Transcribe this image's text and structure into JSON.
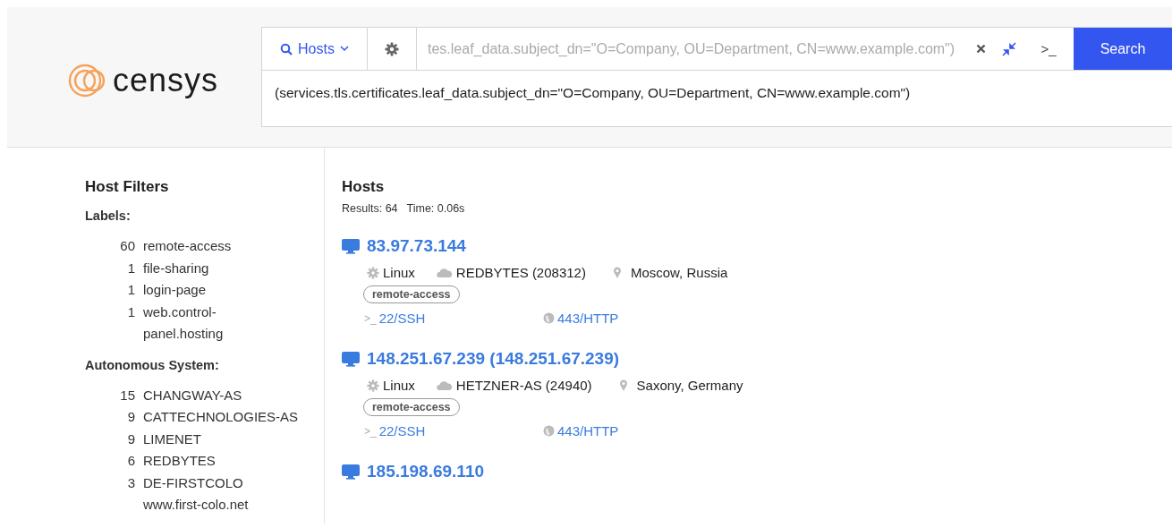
{
  "header": {
    "logo_text": "censys",
    "search": {
      "type_label": "Hosts",
      "value": "tes.leaf_data.subject_dn=\"O=Company, OU=Department, CN=www.example.com\")",
      "terminal_glyph": ">_",
      "button": "Search",
      "query": "(services.tls.certificates.leaf_data.subject_dn=\"O=Company, OU=Department, CN=www.example.com\")"
    }
  },
  "sidebar": {
    "title": "Host Filters",
    "sections": [
      {
        "title": "Labels:",
        "kind": "labels",
        "items": [
          {
            "count": "60",
            "name": "remote-access"
          },
          {
            "count": "1",
            "name": "file-sharing"
          },
          {
            "count": "1",
            "name": "login-page"
          },
          {
            "count": "1",
            "name": "web.control-panel.hosting"
          }
        ]
      },
      {
        "title": "Autonomous System:",
        "kind": "as",
        "items": [
          {
            "count": "15",
            "name": "CHANGWAY-AS"
          },
          {
            "count": "9",
            "name": "CATTECHNOLOGIES-AS"
          },
          {
            "count": "9",
            "name": "LIMENET"
          },
          {
            "count": "6",
            "name": "REDBYTES"
          },
          {
            "count": "3",
            "name": "DE-FIRSTCOLO www.first-colo.net"
          }
        ]
      }
    ]
  },
  "results": {
    "title": "Hosts",
    "summary": [
      "Results: 64",
      "Time: 0.06s"
    ],
    "hosts": [
      {
        "ip": "83.97.73.144",
        "os": "Linux",
        "as": "REDBYTES (208312)",
        "location": "Moscow, Russia",
        "labels": [
          "remote-access"
        ],
        "services": [
          {
            "kind": "terminal",
            "glyph": ">_",
            "name": "22/SSH"
          },
          {
            "kind": "web",
            "name": "443/HTTP"
          }
        ]
      },
      {
        "ip": "148.251.67.239 (148.251.67.239)",
        "os": "Linux",
        "as": "HETZNER-AS (24940)",
        "location": "Saxony, Germany",
        "labels": [
          "remote-access"
        ],
        "services": [
          {
            "kind": "terminal",
            "glyph": ">_",
            "name": "22/SSH"
          },
          {
            "kind": "web",
            "name": "443/HTTP"
          }
        ]
      },
      {
        "ip": "185.198.69.110"
      }
    ]
  }
}
